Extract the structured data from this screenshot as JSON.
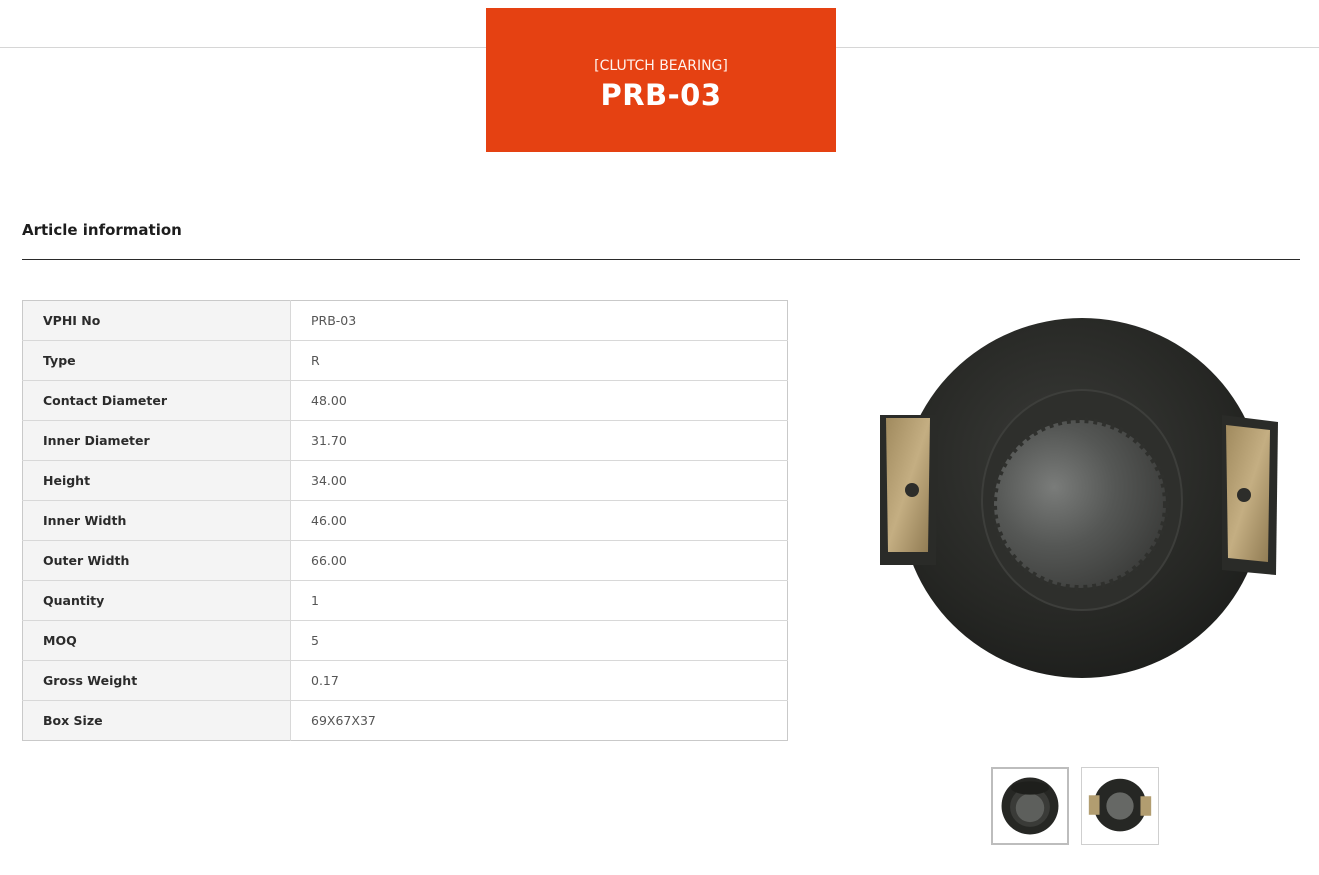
{
  "header": {
    "category": "[CLUTCH BEARING]",
    "model": "PRB-03",
    "accent_color": "#e54112"
  },
  "article": {
    "heading": "Article information",
    "rows": [
      {
        "key": "VPHI No",
        "value": "PRB-03"
      },
      {
        "key": "Type",
        "value": "R"
      },
      {
        "key": "Contact Diameter",
        "value": "48.00"
      },
      {
        "key": "Inner Diameter",
        "value": "31.70"
      },
      {
        "key": "Height",
        "value": "34.00"
      },
      {
        "key": "Inner Width",
        "value": "46.00"
      },
      {
        "key": "Outer Width",
        "value": "66.00"
      },
      {
        "key": "Quantity",
        "value": "1"
      },
      {
        "key": "MOQ",
        "value": "5"
      },
      {
        "key": "Gross Weight",
        "value": "0.17"
      },
      {
        "key": "Box Size",
        "value": "69X67X37"
      }
    ]
  },
  "gallery": {
    "main_image": "clutch-bearing-side-view",
    "thumbnails": [
      "clutch-bearing-front-view",
      "clutch-bearing-side-view"
    ]
  }
}
